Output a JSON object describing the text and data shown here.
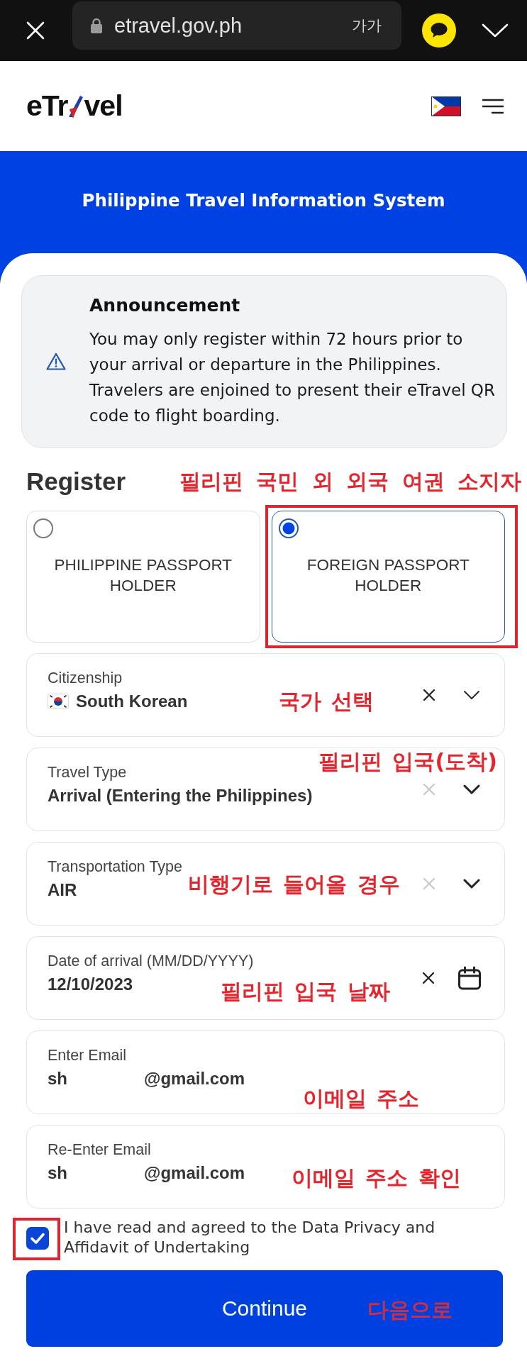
{
  "browser_bar": {
    "url": "etravel.gov.ph",
    "text_size_button": "가가"
  },
  "header": {
    "logo_parts": [
      "eTr",
      "vel"
    ]
  },
  "banner": {
    "title": "Philippine Travel Information System"
  },
  "announcement": {
    "title": "Announcement",
    "body": "You may only register within 72 hours prior to your arrival or departure in the Philippines. Travelers are enjoined to present their eTravel QR code to flight boarding."
  },
  "register": {
    "title": "Register",
    "annotation": "필리핀 국민 외 외국 여권 소지자",
    "options": [
      {
        "label": "PHILIPPINE PASSPORT HOLDER",
        "selected": false,
        "highlighted": false
      },
      {
        "label": "FOREIGN PASSPORT HOLDER",
        "selected": true,
        "highlighted": true
      }
    ]
  },
  "fields": [
    {
      "kind": "country",
      "label": "Citizenship",
      "value": "South Korean",
      "clearable": true,
      "annotation": "국가 선택"
    },
    {
      "kind": "select",
      "label": "Travel Type",
      "value": "Arrival (Entering the Philippines)",
      "clearable": false,
      "annotation": "필리핀 입국(도착)"
    },
    {
      "kind": "select",
      "label": "Transportation Type",
      "value": "AIR",
      "clearable": false,
      "annotation": "비행기로 들어올 경우"
    },
    {
      "kind": "date",
      "label": "Date of arrival (MM/DD/YYYY)",
      "value": "12/10/2023",
      "clearable": true,
      "annotation": "필리핀 입국 날짜"
    },
    {
      "kind": "email",
      "label": "Enter Email",
      "value_parts": [
        "sh",
        "@gmail.com"
      ],
      "annotation": "이메일 주소"
    },
    {
      "kind": "email",
      "label": "Re-Enter Email",
      "value_parts": [
        "sh",
        "@gmail.com"
      ],
      "annotation": "이메일 주소 확인"
    }
  ],
  "agreement": {
    "text": "I have read and agreed to the Data Privacy and Affidavit of Undertaking",
    "checked": true,
    "highlighted": true
  },
  "continue_button": {
    "label": "Continue",
    "annotation": "다음으로"
  }
}
